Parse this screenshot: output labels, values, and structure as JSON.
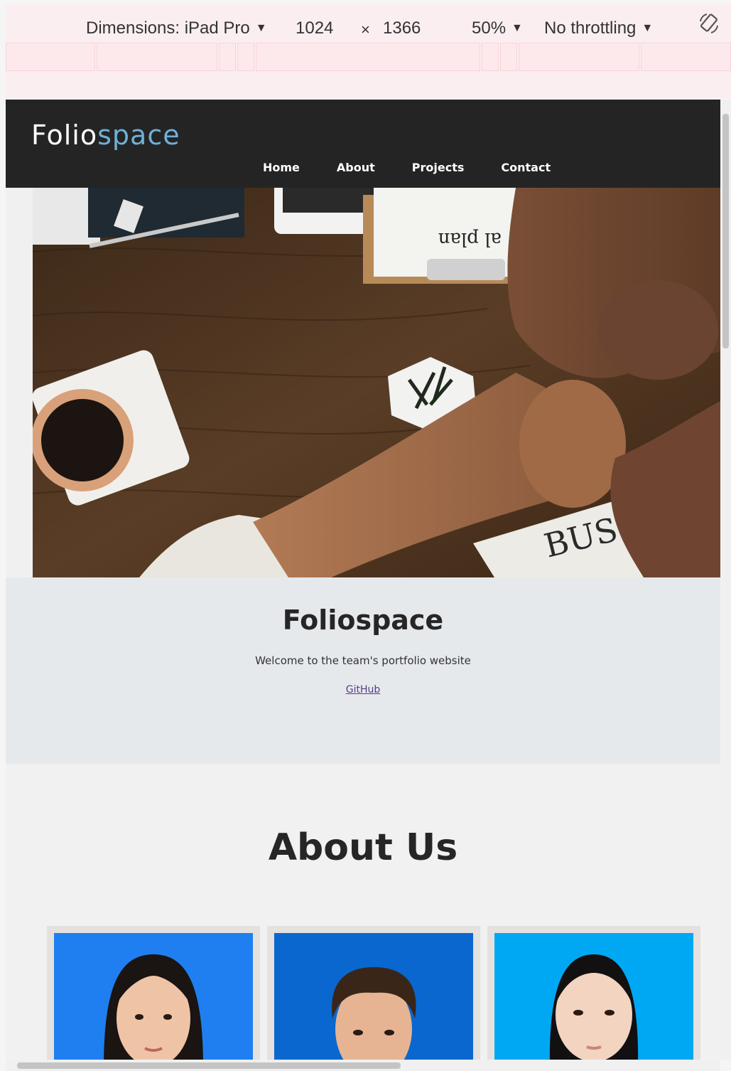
{
  "devtools": {
    "dimensions_label": "Dimensions: iPad Pro",
    "width": "1024",
    "times": "×",
    "height": "1366",
    "zoom": "50%",
    "throttling": "No throttling"
  },
  "site": {
    "logo_part1": "Folio",
    "logo_part2": "space",
    "nav": [
      "Home",
      "About",
      "Projects",
      "Contact"
    ]
  },
  "intro": {
    "title": "Foliospace",
    "subtitle": "Welcome to the team's portfolio website",
    "link": "GitHub"
  },
  "about": {
    "title": "About Us",
    "photo_bg": [
      "#1f7ff0",
      "#0a67cf",
      "#00a8f4"
    ]
  }
}
